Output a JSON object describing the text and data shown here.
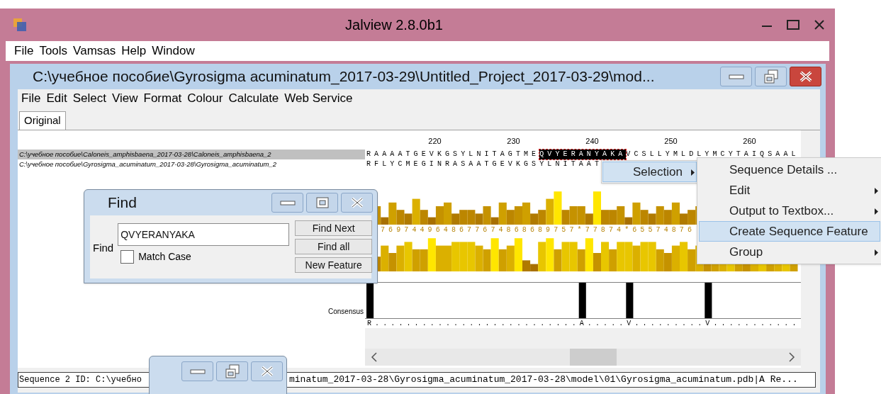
{
  "window": {
    "title": "Jalview 2.8.0b1"
  },
  "menu_bar": [
    "File",
    "Tools",
    "Vamsas",
    "Help",
    "Window"
  ],
  "document": {
    "title": "C:\\учебное пособие\\Gyrosigma acuminatum_2017-03-29\\Untitled_Project_2017-03-29\\mod...",
    "menu_bar": [
      "File",
      "Edit",
      "Select",
      "View",
      "Format",
      "Colour",
      "Calculate",
      "Web Service"
    ],
    "tabs": [
      {
        "label": "Original",
        "selected": true
      }
    ],
    "ruler": [
      "220",
      "230",
      "240",
      "250",
      "260"
    ],
    "sequences": [
      {
        "id": "C:\\учебное пособие\\Caloneis_amphisbaena_2017-03-28\\Caloneis_amphisbaena_2",
        "selected": true,
        "residues": "RAAAATGEVKGSYLNITAGTME",
        "highlight": "QVYERANYAKA",
        "residues_after": "VCSLLYMLDLYMCYTAIQSAAL"
      },
      {
        "id": "C:\\учебное пособие\\Gyrosigma_acuminatum_2017-03-28\\Gyrosigma_acuminatum_2",
        "selected": false,
        "residues": "RFLYCMEGINRASAATGEVKGSYLNITAAT"
      }
    ],
    "conservation": "7697449648677674868689757*77874*65574876",
    "consensus_label": "Consensus",
    "consensus": "R..........................A.....V.........V..........."
  },
  "status_bar": {
    "left": "Sequence 2 ID: C:\\учебно",
    "right": "minatum_2017-03-28\\Gyrosigma_acuminatum_2017-03-28\\model\\01\\Gyrosigma_acuminatum.pdb|A  Re..."
  },
  "find_dialog": {
    "title": "Find",
    "label": "Find",
    "value": "QVYERANYAKA",
    "match_case": {
      "label": "Match Case",
      "checked": false
    },
    "buttons": [
      "Find Next",
      "Find all",
      "New Feature"
    ]
  },
  "context_menu": {
    "items": [
      {
        "label": "Selection",
        "selected": true,
        "submenu": true
      }
    ]
  },
  "submenu": {
    "items": [
      {
        "label": "Sequence Details ...",
        "selected": false,
        "submenu": false
      },
      {
        "label": "Edit",
        "selected": false,
        "submenu": true
      },
      {
        "label": "Output to Textbox...",
        "selected": false,
        "submenu": true
      },
      {
        "label": "Create Sequence Feature",
        "selected": true,
        "submenu": false
      },
      {
        "label": "Group",
        "selected": false,
        "submenu": true
      }
    ]
  }
}
